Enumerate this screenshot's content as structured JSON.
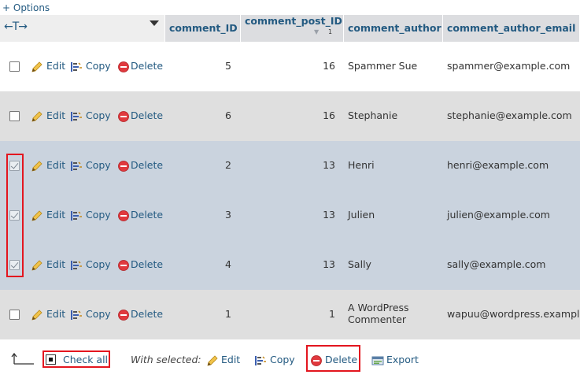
{
  "options_link": "+ Options",
  "header": {
    "arrows": "←T→",
    "columns": {
      "comment_id": "comment_ID",
      "comment_post_id": "comment_post_ID",
      "comment_post_id_sort_order": "1",
      "comment_author": "comment_author",
      "comment_author_email": "comment_author_email"
    }
  },
  "row_actions": {
    "edit": "Edit",
    "copy": "Copy",
    "delete": "Delete"
  },
  "rows": [
    {
      "comment_id": "5",
      "comment_post_id": "16",
      "comment_author": "Spammer Sue",
      "comment_author_email": "spammer@example.com",
      "checked": false
    },
    {
      "comment_id": "6",
      "comment_post_id": "16",
      "comment_author": "Stephanie",
      "comment_author_email": "stephanie@example.com",
      "checked": false
    },
    {
      "comment_id": "2",
      "comment_post_id": "13",
      "comment_author": "Henri",
      "comment_author_email": "henri@example.com",
      "checked": true
    },
    {
      "comment_id": "3",
      "comment_post_id": "13",
      "comment_author": "Julien",
      "comment_author_email": "julien@example.com",
      "checked": true
    },
    {
      "comment_id": "4",
      "comment_post_id": "13",
      "comment_author": "Sally",
      "comment_author_email": "sally@example.com",
      "checked": true
    },
    {
      "comment_id": "1",
      "comment_post_id": "1",
      "comment_author": "A WordPress Commenter",
      "comment_author_email": "wapuu@wordpress.example",
      "checked": false
    }
  ],
  "footer": {
    "check_all": "Check all",
    "with_selected": "With selected:",
    "edit": "Edit",
    "copy": "Copy",
    "delete": "Delete",
    "export": "Export"
  },
  "colors": {
    "link": "#235a81",
    "header_bg": "#dcdde0",
    "row_even_bg": "#dfdfdf",
    "row_marked_bg": "#cad3de",
    "highlight": "#e3161f",
    "delete_icon": "#e0393e"
  }
}
